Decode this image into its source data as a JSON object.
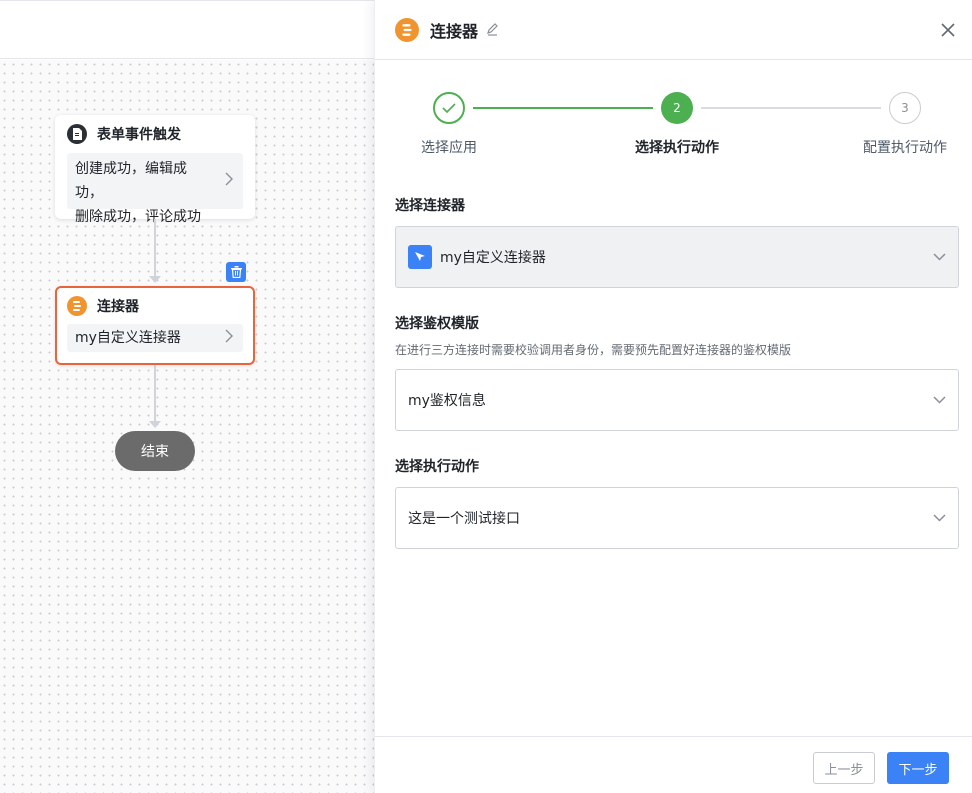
{
  "canvas": {
    "trigger_node": {
      "title": "表单事件触发",
      "line1": "创建成功，编辑成功，",
      "line2": "删除成功，评论成功"
    },
    "connector_node": {
      "title": "连接器",
      "value": "my自定义连接器"
    },
    "end_node": {
      "label": "结束"
    }
  },
  "panel": {
    "title": "连接器",
    "steps": [
      {
        "label": "选择应用",
        "state": "done"
      },
      {
        "label": "选择执行动作",
        "state": "active",
        "number": "2"
      },
      {
        "label": "配置执行动作",
        "state": "todo",
        "number": "3"
      }
    ],
    "connector_field": {
      "label": "选择连接器",
      "value": "my自定义连接器"
    },
    "auth_field": {
      "label": "选择鉴权模版",
      "hint": "在进行三方连接时需要校验调用者身份，需要预先配置好连接器的鉴权模版",
      "value": "my鉴权信息"
    },
    "action_field": {
      "label": "选择执行动作",
      "value": "这是一个测试接口"
    },
    "footer": {
      "prev_label": "上一步",
      "next_label": "下一步"
    }
  },
  "colors": {
    "accent": "#3b82f6",
    "success": "#4caf50",
    "connector": "#f0942f",
    "selected_border": "#e8643c"
  }
}
